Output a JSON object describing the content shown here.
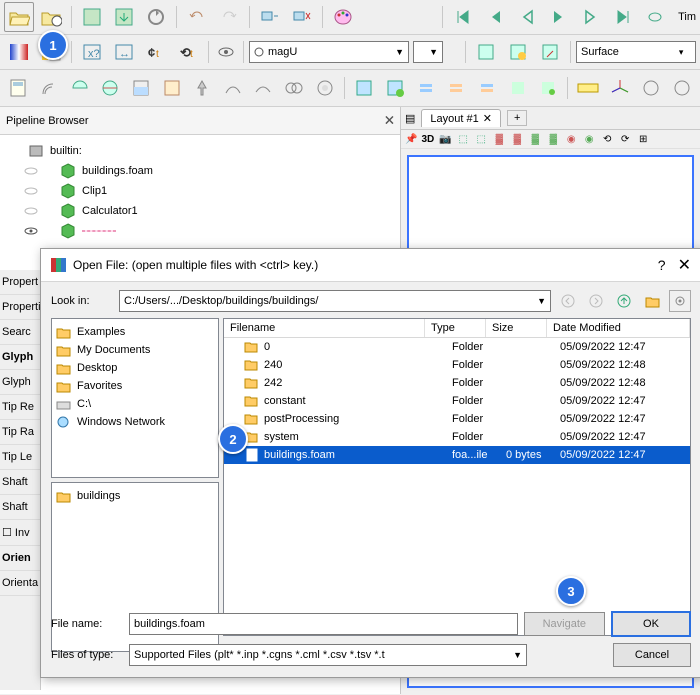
{
  "toolbar1_combo": "magU",
  "toolbar1_repr": "Surface",
  "time_label": "Tim",
  "pipeline": {
    "title": "Pipeline Browser",
    "items": [
      {
        "label": "builtin:"
      },
      {
        "label": "buildings.foam"
      },
      {
        "label": "Clip1"
      },
      {
        "label": "Calculator1"
      },
      {
        "label": " "
      }
    ]
  },
  "layout_tab": "Layout #1",
  "view3d": "3D",
  "properties": {
    "tab": "Propert",
    "lines": [
      "Propertie",
      "Searc",
      "Glyph",
      "Glyph",
      "Tip Re",
      "Tip Ra",
      "Tip Le",
      "Shaft",
      "Shaft",
      "☐ Inv",
      "Orien",
      "Orienta"
    ]
  },
  "dialog": {
    "title": "Open File:  (open multiple files with <ctrl> key.)",
    "look_in_label": "Look in:",
    "look_in_path": "C:/Users/.../Desktop/buildings/buildings/",
    "shortcuts": [
      "Examples",
      "My Documents",
      "Desktop",
      "Favorites",
      "C:\\",
      "Windows Network"
    ],
    "columns": {
      "name": "Filename",
      "type": "Type",
      "size": "Size",
      "date": "Date Modified"
    },
    "files": [
      {
        "name": "0",
        "type": "Folder",
        "size": "",
        "date": "05/09/2022 12:47",
        "folder": true
      },
      {
        "name": "240",
        "type": "Folder",
        "size": "",
        "date": "05/09/2022 12:48",
        "folder": true
      },
      {
        "name": "242",
        "type": "Folder",
        "size": "",
        "date": "05/09/2022 12:48",
        "folder": true
      },
      {
        "name": "constant",
        "type": "Folder",
        "size": "",
        "date": "05/09/2022 12:47",
        "folder": true
      },
      {
        "name": "postProcessing",
        "type": "Folder",
        "size": "",
        "date": "05/09/2022 12:47",
        "folder": true
      },
      {
        "name": "system",
        "type": "Folder",
        "size": "",
        "date": "05/09/2022 12:47",
        "folder": true
      },
      {
        "name": "buildings.foam",
        "type": "foa...ile",
        "size": "0 bytes",
        "date": "05/09/2022 12:47",
        "folder": false,
        "selected": true
      }
    ],
    "recent": [
      "buildings"
    ],
    "file_name_label": "File name:",
    "file_name_value": "buildings.foam",
    "files_of_type_label": "Files of type:",
    "files_of_type_value": "Supported Files (plt* *.inp *.cgns *.cml *.csv *.tsv *.t",
    "navigate": "Navigate",
    "ok": "OK",
    "cancel": "Cancel"
  },
  "badges": {
    "1": "1",
    "2": "2",
    "3": "3"
  }
}
